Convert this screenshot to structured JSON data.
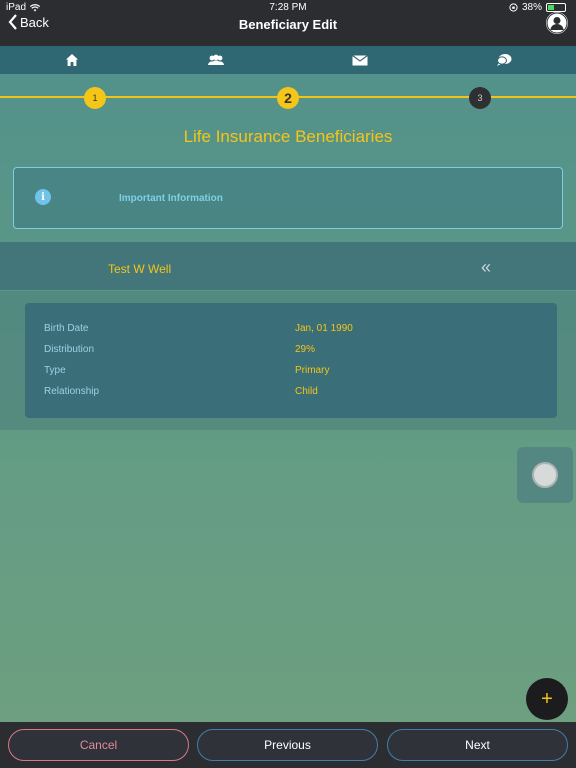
{
  "status_bar": {
    "device": "iPad",
    "time": "7:28 PM",
    "battery": "38%",
    "battery_level": 0.38
  },
  "nav": {
    "back_label": "Back",
    "title": "Beneficiary Edit"
  },
  "tabs": [
    {
      "icon": "home-icon"
    },
    {
      "icon": "people-icon"
    },
    {
      "icon": "mail-icon"
    },
    {
      "icon": "chat-icon"
    }
  ],
  "stepper": {
    "steps": [
      "1",
      "2",
      "3"
    ],
    "current": 2
  },
  "page_title": "Life Insurance Beneficiaries",
  "info_box": {
    "icon_glyph": "i",
    "label": "Important Information"
  },
  "beneficiary": {
    "name": "Test W Well",
    "collapse_glyph": "«",
    "details": [
      {
        "label": "Birth Date",
        "value": "Jan, 01 1990"
      },
      {
        "label": "Distribution",
        "value": "29%"
      },
      {
        "label": "Type",
        "value": "Primary"
      },
      {
        "label": "Relationship",
        "value": "Child"
      }
    ]
  },
  "add_button_glyph": "+",
  "footer": {
    "cancel": "Cancel",
    "previous": "Previous",
    "next": "Next"
  },
  "colors": {
    "accent": "#f5c518",
    "info": "#7fcfe6",
    "cancel": "#e08a9a"
  }
}
